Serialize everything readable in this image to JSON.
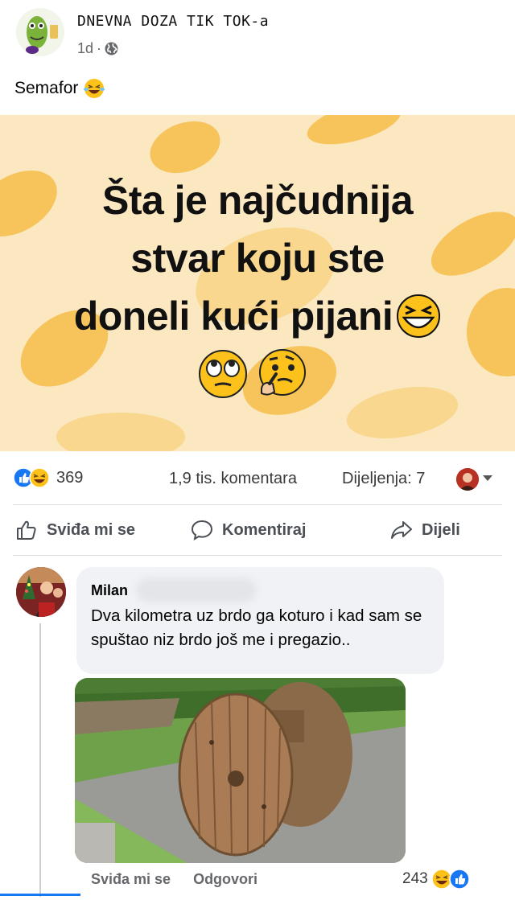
{
  "post": {
    "page_name": "DNEVNA DOZA TIK TOK-a",
    "time": "1d",
    "dot": "·",
    "text": "Semafor",
    "image_text": {
      "line1": "Šta je najčudnija",
      "line2": "stvar koju ste",
      "line3": "doneli kući pijani"
    }
  },
  "stats": {
    "reactions": "369",
    "comments": "1,9 tis. komentara",
    "shares": "Dijeljenja: 7"
  },
  "actions": {
    "like": "Sviđa mi se",
    "comment": "Komentiraj",
    "share": "Dijeli"
  },
  "comment": {
    "author": "Milan",
    "text": "Dva kilometra uz brdo ga koturo i kad sam se spuštao niz brdo još me i pregazio..",
    "like": "Sviđa mi se",
    "reply": "Odgovori",
    "reaction_count": "243"
  },
  "colors": {
    "fb_blue": "#1877f2",
    "image_bg": "#fbe7c0",
    "blob": "#f7c45c"
  }
}
